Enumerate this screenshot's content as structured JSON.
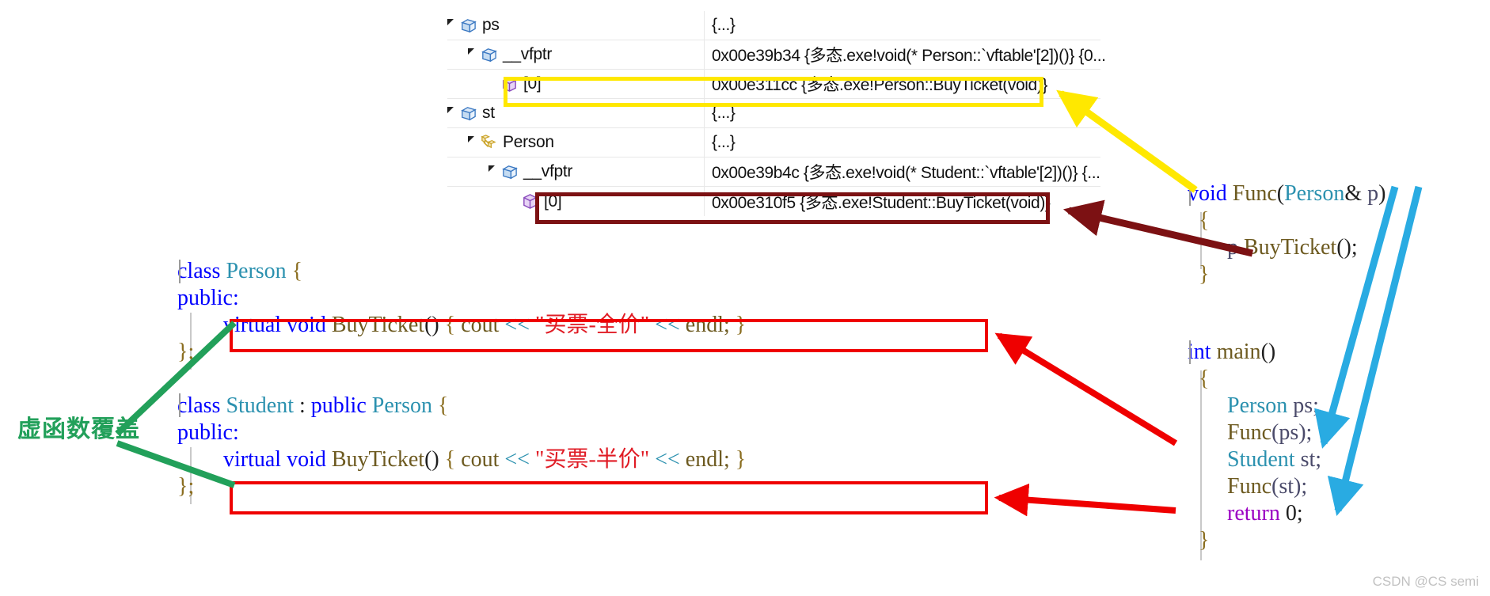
{
  "watch": {
    "rows": [
      {
        "id": "ps",
        "depth": 0,
        "expandable": true,
        "icon": "field-box-icon",
        "name": "ps",
        "value": "{...}"
      },
      {
        "id": "ps-vfptr",
        "depth": 1,
        "expandable": true,
        "icon": "field-box-icon",
        "name": "__vfptr",
        "value": "0x00e39b34 {多态.exe!void(* Person::`vftable'[2])()} {0..."
      },
      {
        "id": "ps-vfptr-0",
        "depth": 2,
        "expandable": false,
        "icon": "element-cube-icon",
        "name": "[0]",
        "value": "0x00e311cc {多态.exe!Person::BuyTicket(void)}"
      },
      {
        "id": "st",
        "depth": 0,
        "expandable": true,
        "icon": "field-box-icon",
        "name": "st",
        "value": "{...}"
      },
      {
        "id": "st-person",
        "depth": 1,
        "expandable": true,
        "icon": "base-class-icon",
        "name": "Person",
        "value": "{...}"
      },
      {
        "id": "st-person-vfptr",
        "depth": 2,
        "expandable": true,
        "icon": "field-box-icon",
        "name": "__vfptr",
        "value": "0x00e39b4c {多态.exe!void(* Student::`vftable'[2])()} {..."
      },
      {
        "id": "st-person-vfptr-0",
        "depth": 3,
        "expandable": false,
        "icon": "element-cube-icon",
        "name": "[0]",
        "value": "0x00e310f5 {多态.exe!Student::BuyTicket(void)}"
      }
    ]
  },
  "code_person": {
    "line1_kw": "class",
    "line1_type": "Person",
    "line1_brace": "{",
    "line2": "public:",
    "line3_virtual": "virtual",
    "line3_void": "void",
    "line3_name": "BuyTicket",
    "line3_parens": "()",
    "line3_open": "{",
    "line3_cout": "cout",
    "line3_shift1": "<<",
    "line3_string": "\"买票-全价\"",
    "line3_shift2": "<<",
    "line3_endl": "endl;",
    "line3_close": "}",
    "line4": "};"
  },
  "code_student": {
    "line1_kw": "class",
    "line1_type": "Student",
    "line1_colon": ":",
    "line1_public": "public",
    "line1_base": "Person",
    "line1_brace": "{",
    "line2": "public:",
    "line3_virtual": "virtual",
    "line3_void": "void",
    "line3_name": "BuyTicket",
    "line3_parens": "()",
    "line3_open": "{",
    "line3_cout": "cout",
    "line3_shift1": "<<",
    "line3_string": "\"买票-半价\"",
    "line3_shift2": "<<",
    "line3_endl": "endl;",
    "line3_close": "}",
    "line4": "};"
  },
  "code_func": {
    "line1_void": "void",
    "line1_name": "Func",
    "line1_open": "(",
    "line1_type": "Person",
    "line1_amp": "&",
    "line1_param": "p",
    "line1_closep": ")",
    "line2": "{",
    "line3_obj": "p.",
    "line3_call": "BuyTicket",
    "line3_tail": "();",
    "line4": "}"
  },
  "code_main": {
    "line1_int": "int",
    "line1_name": "main",
    "line1_parens": "()",
    "line2": "{",
    "line3_type": "Person",
    "line3_var": "ps;",
    "line4_name": "Func",
    "line4_args": "(ps);",
    "line5_type": "Student",
    "line5_var": "st;",
    "line6_name": "Func",
    "line6_args": "(st);",
    "line7_kw": "return",
    "line7_val": "0;",
    "line8": "}"
  },
  "annotations": {
    "green_label": "虚函数覆盖",
    "colors": {
      "yellow": "#ffe800",
      "maroon": "#7c1113",
      "red": "#ef0000",
      "green": "#22a05a",
      "blue": "#29abe2"
    }
  },
  "watermark": {
    "text": "CSDN @CS semi"
  }
}
